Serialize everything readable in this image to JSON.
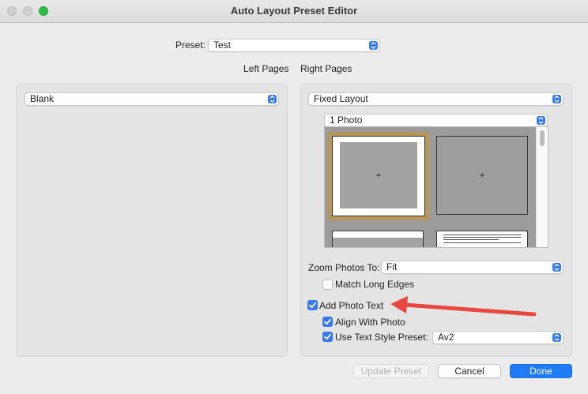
{
  "window": {
    "title": "Auto Layout Preset Editor"
  },
  "preset": {
    "label": "Preset:",
    "value": "Test"
  },
  "columns": {
    "left": "Left Pages",
    "right": "Right Pages"
  },
  "left_panel": {
    "layout_value": "Blank"
  },
  "right_panel": {
    "layout_value": "Fixed Layout",
    "photo_count_value": "1 Photo",
    "photo_marker": "+",
    "zoom": {
      "label": "Zoom Photos To:",
      "value": "Fit"
    },
    "match_long_edges": {
      "label": "Match Long Edges",
      "checked": false
    },
    "add_photo_text": {
      "label": "Add Photo Text",
      "checked": true
    },
    "align_with_photo": {
      "label": "Align With Photo",
      "checked": true
    },
    "use_text_style": {
      "label": "Use Text Style Preset:",
      "checked": true,
      "value": "Av2"
    }
  },
  "buttons": {
    "update_preset": "Update Preset",
    "cancel": "Cancel",
    "done": "Done"
  },
  "colors": {
    "accent": "#3478f6",
    "annotation_arrow": "#e8483d",
    "selection": "#b8965a"
  }
}
